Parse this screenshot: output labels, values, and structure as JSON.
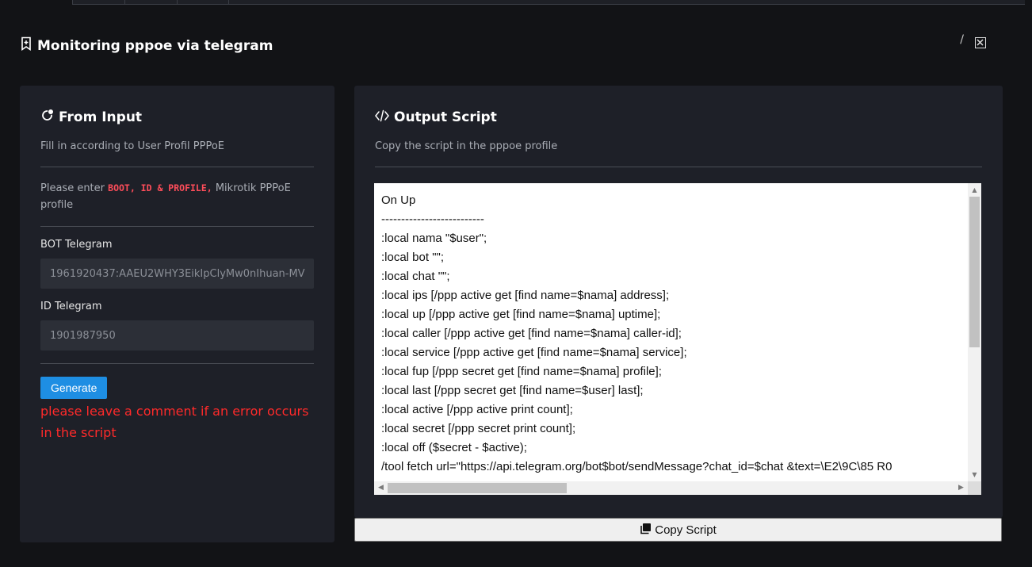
{
  "page": {
    "title": "Monitoring pppoe via telegram",
    "action_slash": "/"
  },
  "form_card": {
    "title": "From Input",
    "subtitle": "Fill in according to User Profil PPPoE",
    "note_prefix": "Please enter",
    "note_code": "BOOT, ID & PROFILE,",
    "note_suffix": " Mikrotik PPPoE profile",
    "bot_label": "BOT Telegram",
    "bot_placeholder": "1961920437:AAEU2WHY3EikIpClyMw0nIhuan-MV",
    "id_label": "ID Telegram",
    "id_placeholder": "1901987950",
    "generate_label": "Generate",
    "error_text": "please leave a comment if an error occurs in the script"
  },
  "output_card": {
    "title": "Output Script",
    "subtitle": "Copy the script in the pppoe profile",
    "script": "On Up\n--------------------------\n:local nama \"$user\";\n:local bot \"\";\n:local chat \"\";\n:local ips [/ppp active get [find name=$nama] address];\n:local up [/ppp active get [find name=$nama] uptime];\n:local caller [/ppp active get [find name=$nama] caller-id];\n:local service [/ppp active get [find name=$nama] service];\n:local fup [/ppp secret get [find name=$nama] profile];\n:local last [/ppp secret get [find name=$user] last];\n:local active [/ppp active print count];\n:local secret [/ppp secret print count];\n:local off ($secret - $active);\n/tool fetch url=\"https://api.telegram.org/bot$bot/sendMessage?chat_id=$chat &text=\\E2\\9C\\85 R0",
    "copy_label": "Copy Script"
  },
  "colors": {
    "background": "#121316",
    "card": "#1e2028",
    "accent": "#1e8ee3",
    "error": "#ff2a2a",
    "code": "#ff4d5a"
  },
  "icons": {
    "page_title": "bookmark-icon",
    "form_card": "refresh-icon",
    "output_card": "code-icon",
    "close": "close-icon",
    "copy": "copy-icon"
  }
}
